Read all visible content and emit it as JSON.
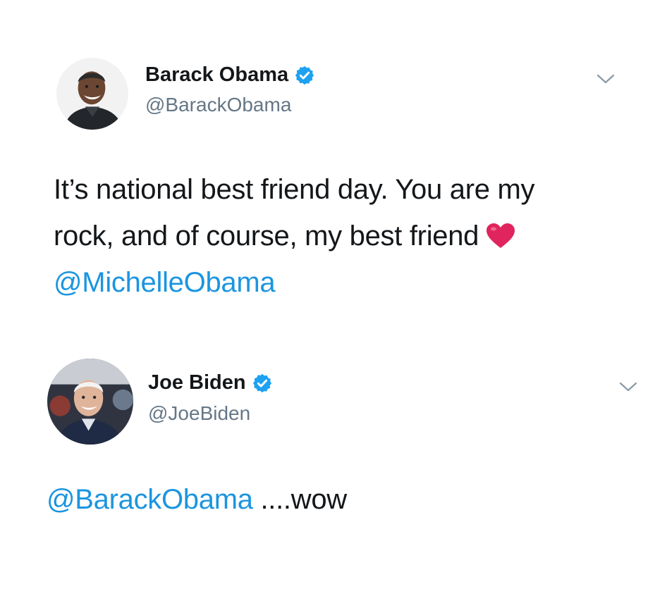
{
  "tweets": [
    {
      "author": {
        "name": "Barack Obama",
        "handle": "@BarackObama",
        "verified": true
      },
      "text": {
        "line1": "It’s national best friend day. You are my",
        "line2": "rock, and of course, my best friend",
        "mention": "@MichelleObama"
      },
      "icons": [
        "avatar",
        "verified-badge-icon",
        "chevron-down-icon",
        "heart-emoji-icon"
      ]
    },
    {
      "author": {
        "name": "Joe Biden",
        "handle": "@JoeBiden",
        "verified": true
      },
      "text": {
        "mention": "@BarackObama",
        "rest": " ....wow"
      },
      "icons": [
        "avatar",
        "verified-badge-icon",
        "chevron-down-icon"
      ]
    }
  ],
  "colors": {
    "mention": "#1b95e0",
    "verified": "#1da1f2",
    "handle": "#657786",
    "text": "#14171a",
    "heart": "#e0245e"
  }
}
